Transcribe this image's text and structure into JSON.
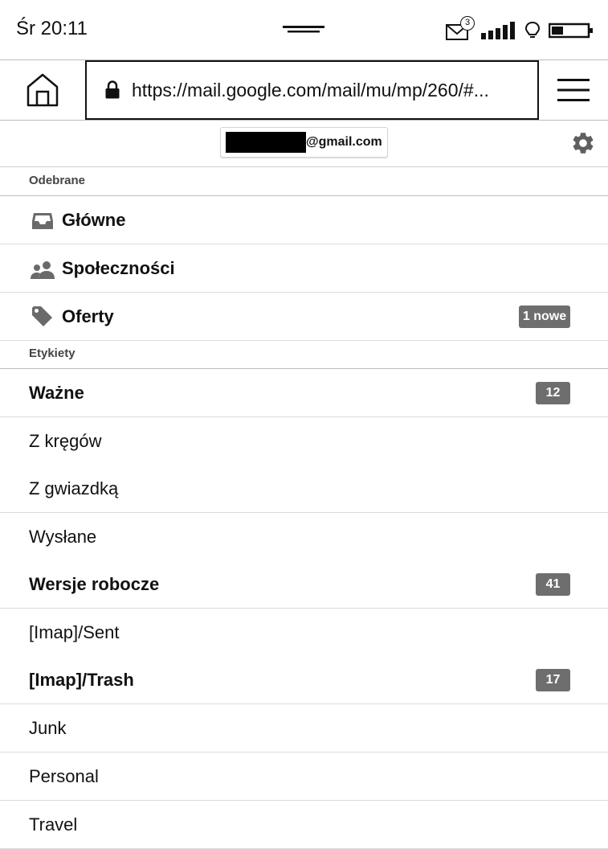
{
  "status_bar": {
    "time": "Śr 20:11",
    "notification_count": "3"
  },
  "browser": {
    "url": "https://mail.google.com/mail/mu/mp/260/#..."
  },
  "account": {
    "email_domain": "@gmail.com"
  },
  "sections": {
    "inbox_header": "Odebrane",
    "labels_header": "Etykiety"
  },
  "inbox_categories": [
    {
      "label": "Główne",
      "icon": "inbox-icon"
    },
    {
      "label": "Społeczności",
      "icon": "people-icon"
    },
    {
      "label": "Oferty",
      "icon": "tag-icon",
      "badge": "1 nowe"
    }
  ],
  "labels": [
    {
      "label": "Ważne",
      "bold": true,
      "badge": "12"
    },
    {
      "label": "Z kręgów",
      "bold": false
    },
    {
      "label": "Z gwiazdką",
      "bold": false
    },
    {
      "label": "Wysłane",
      "bold": false
    },
    {
      "label": "Wersje robocze",
      "bold": true,
      "badge": "41"
    },
    {
      "label": "[Imap]/Sent",
      "bold": false
    },
    {
      "label": "[Imap]/Trash",
      "bold": true,
      "badge": "17"
    },
    {
      "label": "Junk",
      "bold": false
    },
    {
      "label": "Personal",
      "bold": false
    },
    {
      "label": "Travel",
      "bold": false
    }
  ],
  "colors": {
    "badge_bg": "#6e6e6e",
    "text": "#111111",
    "icon": "#6a6a6a"
  }
}
